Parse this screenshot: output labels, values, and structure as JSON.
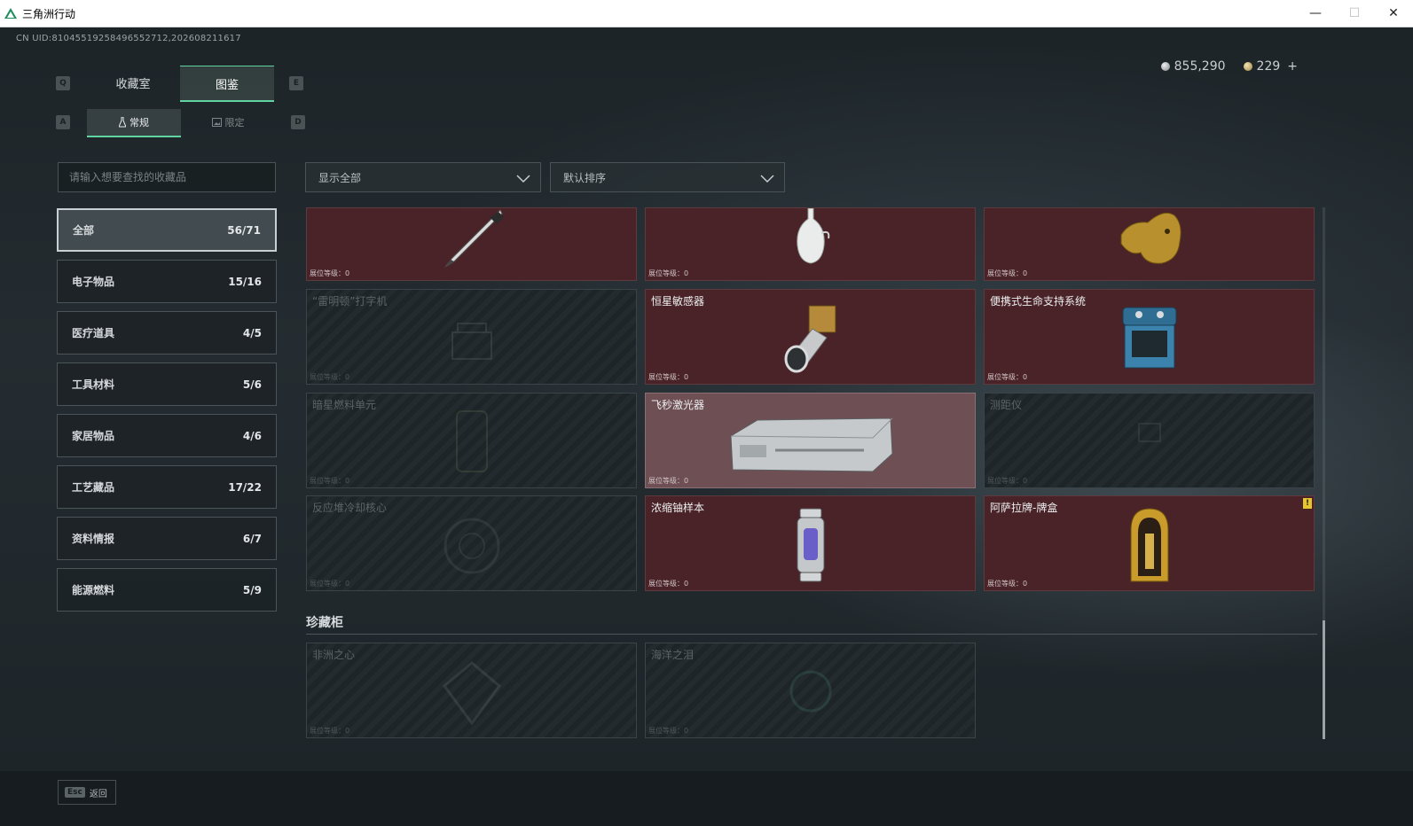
{
  "window": {
    "title": "三角洲行动",
    "controls": [
      "—",
      "☐",
      "✕"
    ]
  },
  "uid": "CN UID:81045519258496552712,202608211617",
  "currency": {
    "silver": "855,290",
    "gold": "229",
    "add": "+"
  },
  "keys": {
    "q": "Q",
    "e": "E",
    "a": "A",
    "d": "D"
  },
  "tabs": [
    {
      "label": "收藏室"
    },
    {
      "label": "图鉴"
    }
  ],
  "subtabs": [
    {
      "label": "常规"
    },
    {
      "label": "限定"
    }
  ],
  "search": {
    "placeholder": "请输入想要查找的收藏品",
    "value": ""
  },
  "filters": {
    "filter": "显示全部",
    "sort": "默认排序"
  },
  "categories": [
    {
      "label": "全部",
      "count": "56/71"
    },
    {
      "label": "电子物品",
      "count": "15/16"
    },
    {
      "label": "医疗道具",
      "count": "4/5"
    },
    {
      "label": "工具材料",
      "count": "5/6"
    },
    {
      "label": "家居物品",
      "count": "4/6"
    },
    {
      "label": "工艺藏品",
      "count": "17/22"
    },
    {
      "label": "资料情报",
      "count": "6/7"
    },
    {
      "label": "能源燃料",
      "count": "5/9"
    }
  ],
  "level_label": "展位等级：",
  "items": [
    {
      "name": "",
      "level": "0",
      "state": "owned",
      "icon": "pen-icon"
    },
    {
      "name": "",
      "level": "0",
      "state": "owned",
      "icon": "vase-icon"
    },
    {
      "name": "",
      "level": "0",
      "state": "owned",
      "icon": "gold-horse-icon"
    },
    {
      "name": "“雷明顿”打字机",
      "level": "0",
      "state": "locked",
      "icon": "typewriter-icon"
    },
    {
      "name": "恒星敏感器",
      "level": "0",
      "state": "owned",
      "icon": "star-sensor-icon"
    },
    {
      "name": "便携式生命支持系统",
      "level": "0",
      "state": "owned",
      "icon": "life-support-icon"
    },
    {
      "name": "暗星燃料单元",
      "level": "0",
      "state": "locked",
      "icon": "fuel-cell-icon"
    },
    {
      "name": "飞秒激光器",
      "level": "0",
      "state": "highlight",
      "icon": "laser-icon"
    },
    {
      "name": "测距仪",
      "level": "0",
      "state": "locked",
      "icon": "rangefinder-icon"
    },
    {
      "name": "反应堆冷却核心",
      "level": "0",
      "state": "locked",
      "icon": "reactor-core-icon"
    },
    {
      "name": "浓缩铀样本",
      "level": "0",
      "state": "owned",
      "icon": "uranium-icon"
    },
    {
      "name": "阿萨拉牌-牌盒",
      "level": "0",
      "state": "owned",
      "icon": "card-box-icon",
      "badge": "!"
    }
  ],
  "section": {
    "title": "珍藏柜"
  },
  "cabinet": [
    {
      "name": "非洲之心",
      "level": "0",
      "state": "locked",
      "icon": "diamond-icon"
    },
    {
      "name": "海洋之泪",
      "level": "0",
      "state": "locked",
      "icon": "gem-icon"
    }
  ],
  "footer": {
    "esc": "Esc",
    "back": "返回"
  },
  "colors": {
    "accent": "#5fd3a0",
    "owned_card": "#4a2328",
    "highlight_card": "#6e4f54",
    "warning": "#e7c52c"
  }
}
